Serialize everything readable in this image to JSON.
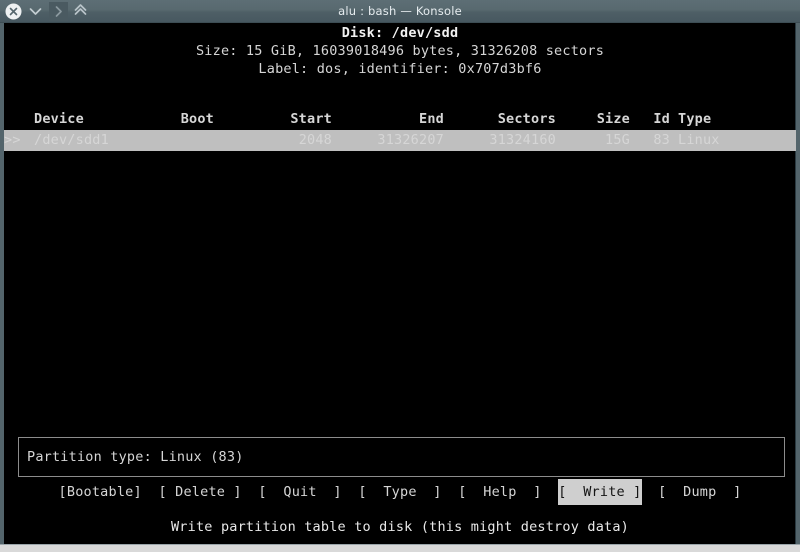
{
  "window": {
    "title": "alu : bash — Konsole",
    "controls": [
      {
        "name": "close-icon",
        "glyph": "x"
      },
      {
        "name": "chevron-down-icon",
        "glyph": "v"
      },
      {
        "name": "chevron-right-icon",
        "glyph": ">"
      },
      {
        "name": "chevron-up-icon",
        "glyph": "^"
      }
    ]
  },
  "colors": {
    "terminal_bg": "#000000",
    "terminal_fg": "#d6d6d6",
    "selection_bg": "#bfbfbf",
    "selection_fg": "#141414",
    "titlebar_bg": "#53646b",
    "box_border": "#8c8c8c"
  },
  "header": {
    "disk": "Disk: /dev/sdd",
    "size": "Size: 15 GiB, 16039018496 bytes, 31326208 sectors",
    "label": "Label: dos, identifier: 0x707d3bf6"
  },
  "table": {
    "columns": [
      "Device",
      "Boot",
      "Start",
      "End",
      "Sectors",
      "Size",
      "Id",
      "Type"
    ],
    "rows": [
      {
        "marker": ">>",
        "device": "/dev/sdd1",
        "boot": "",
        "start": "2048",
        "end": "31326207",
        "sectors": "31324160",
        "size": "15G",
        "id": "83",
        "type": "Linux",
        "selected": true
      }
    ]
  },
  "partition_info": {
    "text": "Partition type: Linux (83)"
  },
  "menu": {
    "items": [
      {
        "label": "[Bootable]",
        "name": "menu-bootable",
        "active": false
      },
      {
        "label": "[ Delete ]",
        "name": "menu-delete",
        "active": false
      },
      {
        "label": "[  Quit  ]",
        "name": "menu-quit",
        "active": false
      },
      {
        "label": "[  Type  ]",
        "name": "menu-type",
        "active": false
      },
      {
        "label": "[  Help  ]",
        "name": "menu-help",
        "active": false
      },
      {
        "label": "[  Write ]",
        "name": "menu-write",
        "active": true
      },
      {
        "label": "[  Dump  ]",
        "name": "menu-dump",
        "active": false
      }
    ],
    "separator": "  "
  },
  "status": {
    "text": "Write partition table to disk (this might destroy data)"
  }
}
